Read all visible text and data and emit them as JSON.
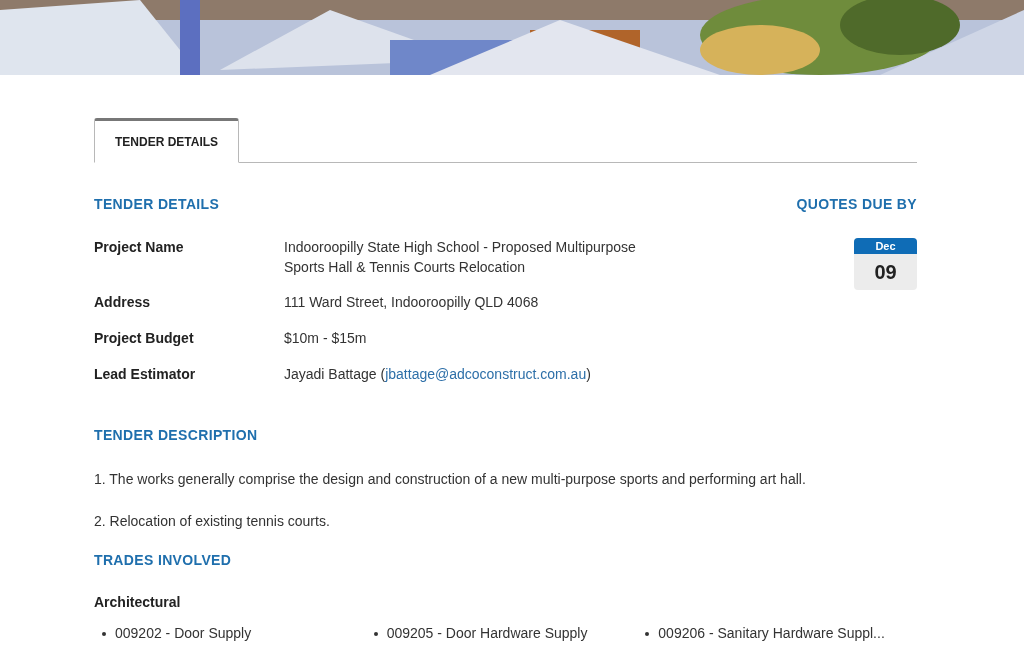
{
  "tabs": [
    {
      "label": "TENDER DETAILS",
      "selected": true
    }
  ],
  "details": {
    "heading": "TENDER DETAILS",
    "rows": [
      {
        "label": "Project Name",
        "value": "Indooroopilly State High School - Proposed Multipurpose Sports Hall & Tennis Courts Relocation"
      },
      {
        "label": "Address",
        "value": "111 Ward Street, Indooroopilly QLD 4068"
      },
      {
        "label": "Project Budget",
        "value": "$10m - $15m"
      },
      {
        "label": "Lead Estimator",
        "value": "Jayadi Battage (",
        "link": "jbattage@adcoconstruct.com.au",
        "suffix": ")"
      }
    ]
  },
  "quotes_due": {
    "heading": "QUOTES DUE BY",
    "month": "Dec",
    "day": "09"
  },
  "description": {
    "heading": "TENDER DESCRIPTION",
    "paragraphs": [
      "1. The works generally comprise the design and construction of a new multi-purpose sports and performing art hall.",
      "2. Relocation of existing tennis courts."
    ]
  },
  "trades": {
    "heading": "TRADES INVOLVED",
    "groups": [
      {
        "name": "Architectural",
        "items": [
          "009202 - Door Supply",
          "009205 - Door Hardware Supply",
          "009206 - Sanitary Hardware Suppl..."
        ]
      }
    ]
  }
}
